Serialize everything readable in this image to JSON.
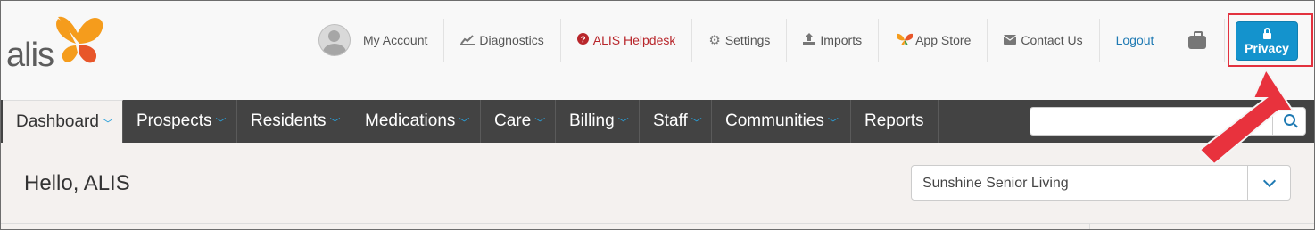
{
  "brand": {
    "logo_text": "alis",
    "colors": {
      "orange": "#f59c1c",
      "red": "#e8562a"
    }
  },
  "topnav": {
    "my_account": "My Account",
    "diagnostics": "Diagnostics",
    "helpdesk": "ALIS Helpdesk",
    "settings": "Settings",
    "imports": "Imports",
    "app_store": "App Store",
    "contact_us": "Contact Us",
    "logout": "Logout",
    "privacy": "Privacy"
  },
  "mainnav": {
    "dashboard": "Dashboard",
    "prospects": "Prospects",
    "residents": "Residents",
    "medications": "Medications",
    "care": "Care",
    "billing": "Billing",
    "staff": "Staff",
    "communities": "Communities",
    "reports": "Reports"
  },
  "search": {
    "value": ""
  },
  "content": {
    "greeting": "Hello, ALIS",
    "community_selected": "Sunshine Senior Living"
  },
  "colors": {
    "nav_bg": "#434343",
    "accent": "#1493cd",
    "highlight": "#e2323f"
  }
}
